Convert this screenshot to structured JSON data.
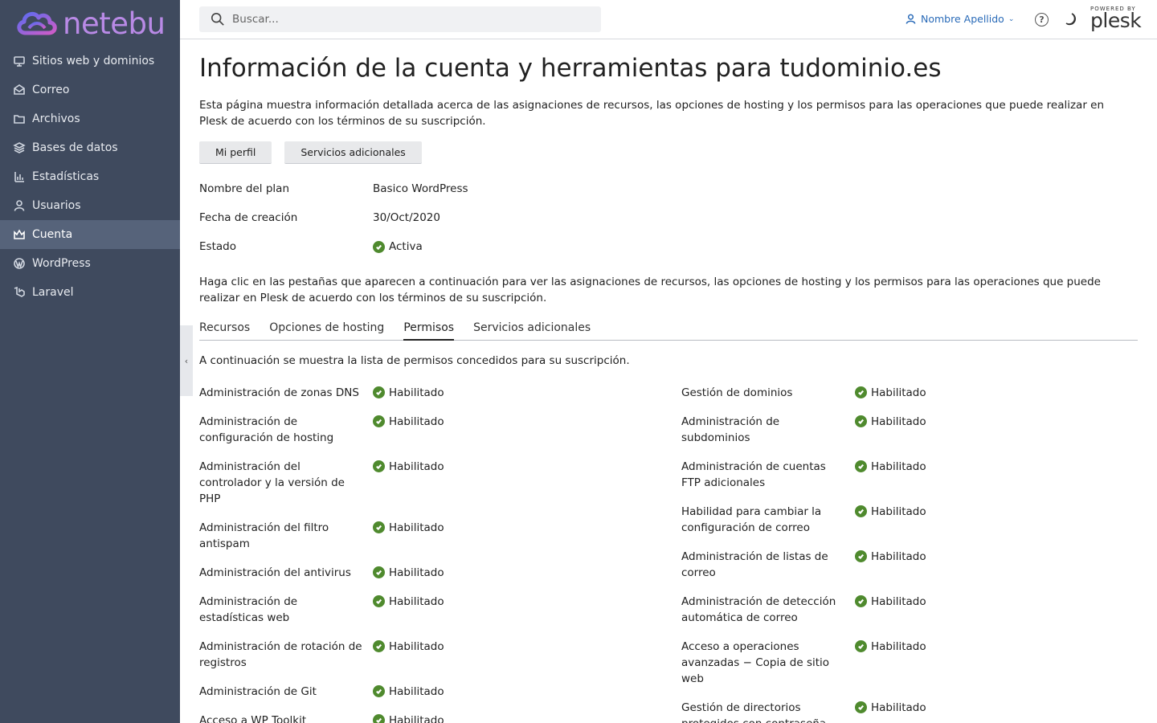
{
  "brand": {
    "name": "netebu",
    "accent": "#b98ae6"
  },
  "sidebar": {
    "items": [
      {
        "label": "Sitios web y dominios",
        "icon": "monitor-icon",
        "active": false
      },
      {
        "label": "Correo",
        "icon": "mail-icon",
        "active": false
      },
      {
        "label": "Archivos",
        "icon": "folder-icon",
        "active": false
      },
      {
        "label": "Bases de datos",
        "icon": "database-icon",
        "active": false
      },
      {
        "label": "Estadísticas",
        "icon": "bar-chart-icon",
        "active": false
      },
      {
        "label": "Usuarios",
        "icon": "user-icon",
        "active": false
      },
      {
        "label": "Cuenta",
        "icon": "crown-icon",
        "active": true
      },
      {
        "label": "WordPress",
        "icon": "wordpress-icon",
        "active": false
      },
      {
        "label": "Laravel",
        "icon": "laravel-icon",
        "active": false
      }
    ]
  },
  "header": {
    "search_placeholder": "Buscar...",
    "user_name": "Nombre Apellido",
    "help_glyph": "?",
    "powered_by": "POWERED BY",
    "plesk": "plesk"
  },
  "main": {
    "title": "Información de la cuenta y herramientas para tudominio.es",
    "intro": "Esta página muestra información detallada acerca de las asignaciones de recursos, las opciones de hosting y los permisos para las operaciones que puede realizar en Plesk de acuerdo con los términos de su suscripción.",
    "buttons": {
      "profile": "Mi perfil",
      "services": "Servicios adicionales"
    },
    "info": {
      "plan_label": "Nombre del plan",
      "plan_value": "Basico WordPress",
      "created_label": "Fecha de creación",
      "created_value": "30/Oct/2020",
      "status_label": "Estado",
      "status_value": "Activa"
    },
    "tabs_intro": "Haga clic en las pestañas que aparecen a continuación para ver las asignaciones de recursos, las opciones de hosting y los permisos para las operaciones que puede realizar en Plesk de acuerdo con los términos de su suscripción.",
    "tabs": [
      "Recursos",
      "Opciones de hosting",
      "Permisos",
      "Servicios adicionales"
    ],
    "active_tab": "Permisos",
    "permissions_intro": "A continuación se muestra la lista de permisos concedidos para su suscripción.",
    "permissions_left": [
      {
        "label": "Administración de zonas DNS",
        "value": "Habilitado"
      },
      {
        "label": "Administración de configuración de hosting",
        "value": "Habilitado"
      },
      {
        "label": "Administración del controlador y la versión de PHP",
        "value": "Habilitado"
      },
      {
        "label": "Administración del filtro antispam",
        "value": "Habilitado"
      },
      {
        "label": "Administración del antivirus",
        "value": "Habilitado"
      },
      {
        "label": "Administración de estadísticas web",
        "value": "Habilitado"
      },
      {
        "label": "Administración de rotación de registros",
        "value": "Habilitado"
      },
      {
        "label": "Administración de Git",
        "value": "Habilitado"
      },
      {
        "label": "Acceso a WP Toolkit",
        "value": "Habilitado"
      }
    ],
    "permissions_right": [
      {
        "label": "Gestión de dominios",
        "value": "Habilitado"
      },
      {
        "label": "Administración de subdominios",
        "value": "Habilitado"
      },
      {
        "label": "Administración de cuentas FTP adicionales",
        "value": "Habilitado"
      },
      {
        "label": "Habilidad para cambiar la configuración de correo",
        "value": "Habilitado"
      },
      {
        "label": "Administración de listas de correo",
        "value": "Habilitado"
      },
      {
        "label": "Administración de detección automática de correo",
        "value": "Habilitado"
      },
      {
        "label": "Acceso a operaciones avanzadas − Copia de sitio web",
        "value": "Habilitado"
      },
      {
        "label": "Gestión de directorios protegidos con contraseña",
        "value": "Habilitado"
      }
    ]
  },
  "colors": {
    "sidebar_bg": "#3f4a5e",
    "sidebar_active": "#56637a",
    "link": "#2a6bb8",
    "enabled_check": "#4f8a2e"
  }
}
